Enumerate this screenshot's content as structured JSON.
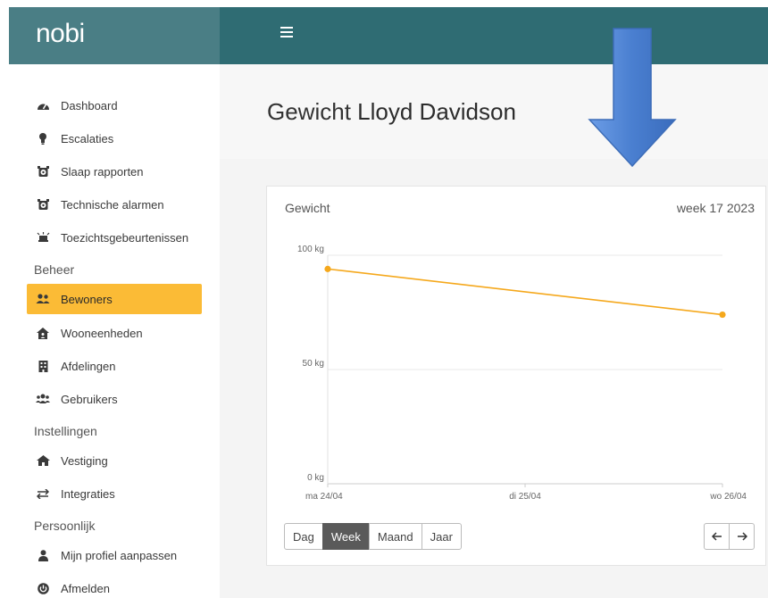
{
  "header": {
    "brand": "nobi"
  },
  "sidebar": {
    "items": [
      {
        "label": "Dashboard",
        "icon": "gauge-icon"
      },
      {
        "label": "Escalaties",
        "icon": "lightbulb-icon"
      },
      {
        "label": "Slaap rapporten",
        "icon": "alarm-clock-icon"
      },
      {
        "label": "Technische alarmen",
        "icon": "alarm-clock-icon"
      },
      {
        "label": "Toezichtsgebeurtenissen",
        "icon": "bed-alert-icon"
      }
    ],
    "beheer": {
      "title": "Beheer",
      "items": [
        {
          "label": "Bewoners",
          "icon": "users-icon",
          "active": true
        },
        {
          "label": "Wooneenheden",
          "icon": "house-user-icon"
        },
        {
          "label": "Afdelingen",
          "icon": "building-icon"
        },
        {
          "label": "Gebruikers",
          "icon": "user-group-icon"
        }
      ]
    },
    "instellingen": {
      "title": "Instellingen",
      "items": [
        {
          "label": "Vestiging",
          "icon": "home-icon"
        },
        {
          "label": "Integraties",
          "icon": "arrows-exchange-icon"
        }
      ]
    },
    "persoonlijk": {
      "title": "Persoonlijk",
      "items": [
        {
          "label": "Mijn profiel aanpassen",
          "icon": "user-icon"
        },
        {
          "label": "Afmelden",
          "icon": "power-off-icon"
        }
      ]
    }
  },
  "page": {
    "title_prefix": "Gewicht",
    "title_name": "Lloyd Davidson"
  },
  "card": {
    "title": "Gewicht",
    "week": "week 17 2023",
    "range_buttons": [
      {
        "label": "Dag",
        "active": false
      },
      {
        "label": "Week",
        "active": true
      },
      {
        "label": "Maand",
        "active": false
      },
      {
        "label": "Jaar",
        "active": false
      }
    ]
  },
  "chart_data": {
    "type": "line",
    "categories": [
      "ma 24/04",
      "di 25/04",
      "wo 26/04"
    ],
    "x": [
      0,
      1,
      2
    ],
    "series": [
      {
        "points": [
          {
            "x": 0,
            "y": 94
          },
          {
            "x": 2,
            "y": 74
          }
        ]
      }
    ],
    "ylim": [
      0,
      100
    ],
    "yticks": [
      {
        "value": 0,
        "label": "0 kg"
      },
      {
        "value": 50,
        "label": "50 kg"
      },
      {
        "value": 100,
        "label": "100 kg"
      }
    ],
    "grid": true,
    "color": "#f5a81c"
  },
  "colors": {
    "brand": "#4a7e85",
    "topbar": "#2f6c73",
    "accent": "#fbbb36",
    "arrow": "#4a7fd0"
  }
}
